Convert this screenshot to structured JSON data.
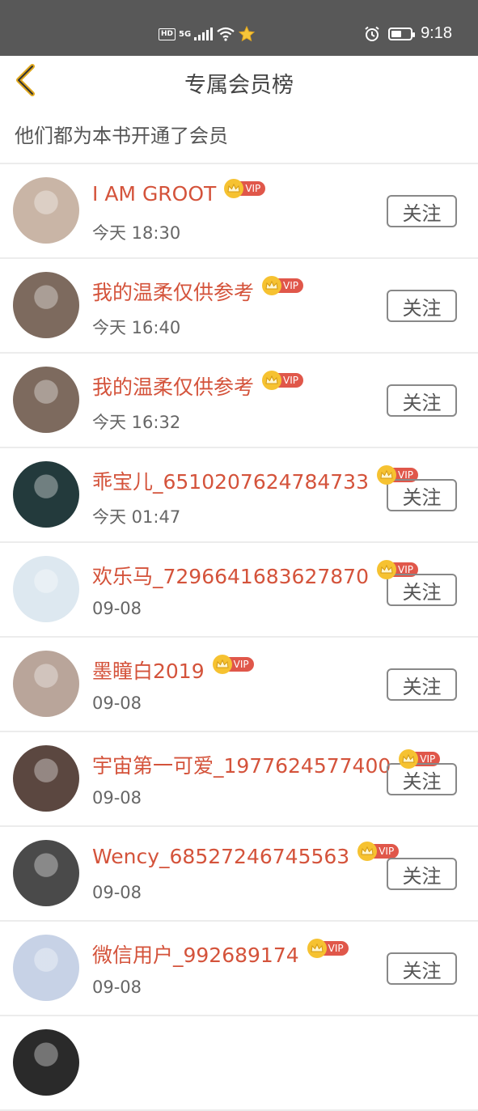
{
  "status_bar": {
    "network_badge": "HD",
    "network_type": "5G",
    "time": "9:18",
    "battery_level": 0.55
  },
  "header": {
    "title": "专属会员榜",
    "subtitle": "他们都为本书开通了会员"
  },
  "vip_label": "VIP",
  "follow_label": "关注",
  "members": [
    {
      "name": "I AM GROOT",
      "time": "今天 18:30",
      "avatar_color": "#c9b5a6"
    },
    {
      "name": "我的温柔仅供参考",
      "time": "今天 16:40",
      "avatar_color": "#7d6a5e"
    },
    {
      "name": "我的温柔仅供参考",
      "time": "今天 16:32",
      "avatar_color": "#7d6a5e"
    },
    {
      "name": "乖宝儿_6510207624784733",
      "time": "今天 01:47",
      "avatar_color": "#233a3c"
    },
    {
      "name": "欢乐马_7296641683627870",
      "time": "09-08",
      "avatar_color": "#dde8f0"
    },
    {
      "name": "墨瞳白2019",
      "time": "09-08",
      "avatar_color": "#b9a59a"
    },
    {
      "name": "宇宙第一可爱_1977624577400",
      "time": "09-08",
      "avatar_color": "#5b4740"
    },
    {
      "name": "Wency_68527246745563",
      "time": "09-08",
      "avatar_color": "#4a4a4a"
    },
    {
      "name": "微信用户_992689174",
      "time": "09-08",
      "avatar_color": "#c7d2e6"
    },
    {
      "name": "",
      "time": "",
      "avatar_color": "#2a2a2a"
    }
  ]
}
